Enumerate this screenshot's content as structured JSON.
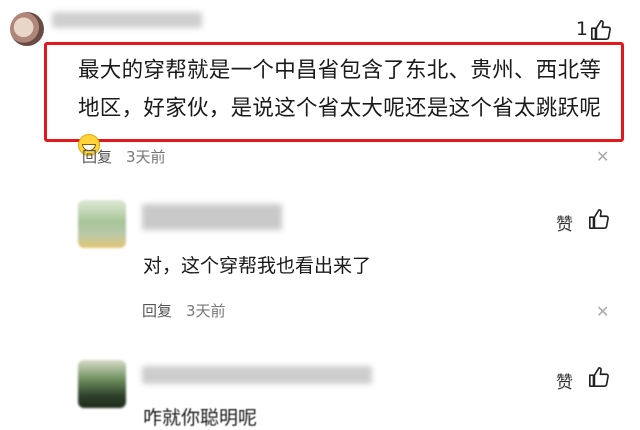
{
  "comment1": {
    "like_count": "1",
    "text": "最大的穿帮就是一个中昌省包含了东北、贵州、西北等地区，好家伙，是说这个省太大呢还是这个省太跳跃呢",
    "reply_label": "回复",
    "time": "3天前"
  },
  "comment2": {
    "like_label": "赞",
    "text": "对，这个穿帮我也看出来了",
    "reply_label": "回复",
    "time": "3天前"
  },
  "comment3": {
    "like_label": "赞",
    "text": "咋就你聪明呢"
  },
  "colors": {
    "highlight_border": "#e3171c"
  }
}
